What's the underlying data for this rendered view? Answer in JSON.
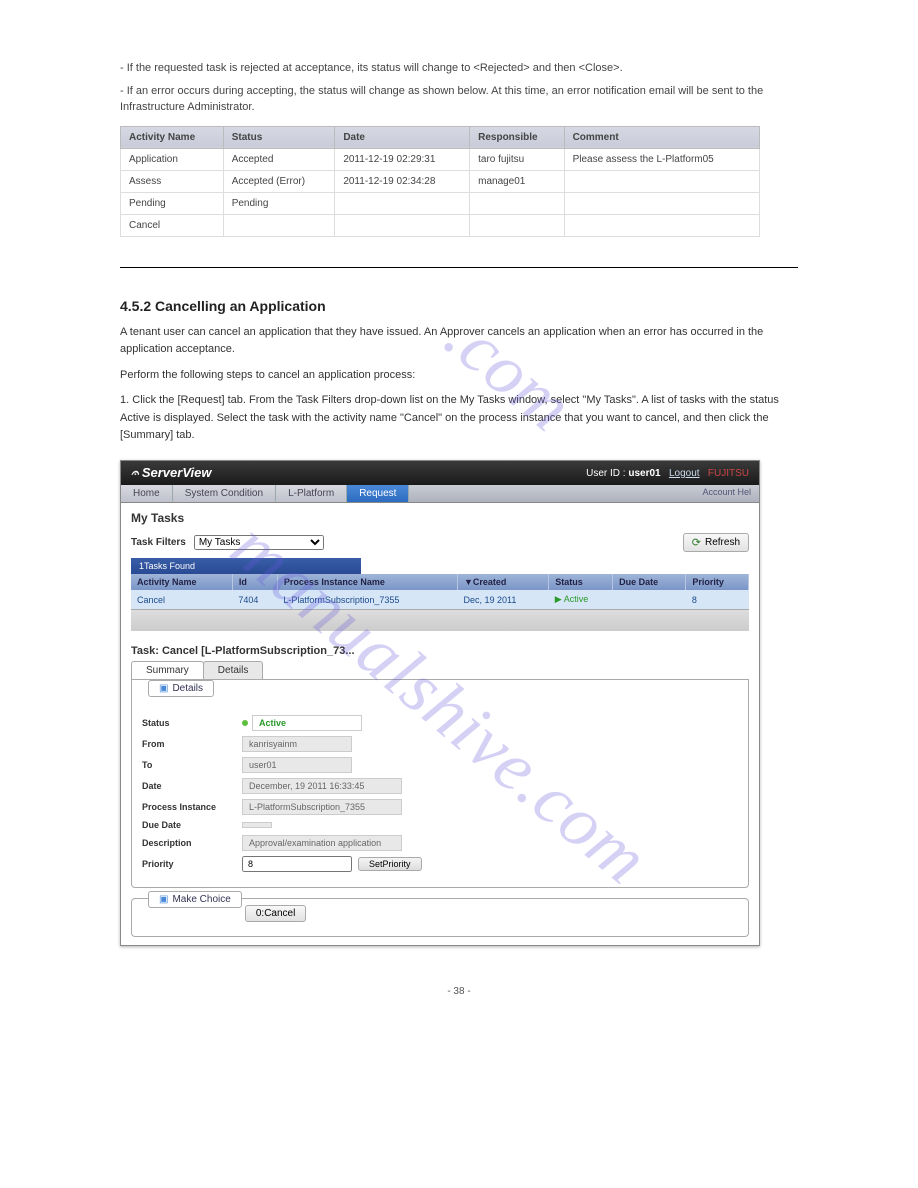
{
  "top_intro": "- If the requested task is rejected at acceptance, its status will change to <Rejected> and then <Close>.",
  "top_intro2": "- If an error occurs during accepting, the status will change as shown below. At this time, an error notification email will be sent to the Infrastructure Administrator.",
  "activity_table": {
    "headers": [
      "Activity Name",
      "Status",
      "Date",
      "Responsible",
      "Comment"
    ],
    "rows": [
      [
        "Application",
        "Accepted",
        "2011-12-19 02:29:31",
        "taro fujitsu",
        "Please assess the L-Platform05"
      ],
      [
        "Assess",
        "Accepted (Error)",
        "2011-12-19 02:34:28",
        "manage01",
        ""
      ],
      [
        "Pending",
        "Pending",
        "",
        "",
        ""
      ],
      [
        "Cancel",
        "",
        "",
        "",
        ""
      ]
    ]
  },
  "section_heading": "4.5.2 Cancelling an Application",
  "para1": "A tenant user can cancel an application that they have issued. An Approver cancels an application when an error has occurred in the application acceptance.",
  "para2": "Perform the following steps to cancel an application process:",
  "step1_label": "1.",
  "step1_text": "Click the [Request] tab. From the Task Filters drop-down list on the My Tasks window, select \"My Tasks\". A list of tasks with the status Active is displayed. Select the task with the activity name \"Cancel\" on the process instance that you want to cancel, and then click the [Summary] tab.",
  "sv": {
    "brand": "ServerView",
    "user_label": "User ID :",
    "user_id": "user01",
    "logout": "Logout",
    "logo": "FUJITSU",
    "tabs": [
      "Home",
      "System Condition",
      "L-Platform",
      "Request"
    ],
    "active_tab": 3,
    "account": "Account  Hel",
    "my_tasks": "My Tasks",
    "filter_label": "Task Filters",
    "filter_value": "My Tasks",
    "refresh": "Refresh",
    "tasks_found": "1Tasks Found",
    "grid_headers": [
      "Activity Name",
      "Id",
      "Process Instance Name",
      "Created",
      "Status",
      "Due Date",
      "Priority"
    ],
    "grid_row": {
      "activity": "Cancel",
      "id": "7404",
      "instance": "L-PlatformSubscription_7355",
      "created": "Dec, 19 2011",
      "status": "Active",
      "due": "",
      "priority": "8"
    },
    "task_title": "Task: Cancel [L-PlatformSubscription_73...",
    "inner_tabs": [
      "Summary",
      "Details"
    ],
    "active_inner": 0,
    "details_legend": "Details",
    "fields": {
      "status_label": "Status",
      "status_val": "Active",
      "from_label": "From",
      "from_val": "kanrisyainm",
      "to_label": "To",
      "to_val": "user01",
      "date_label": "Date",
      "date_val": "December, 19 2011 16:33:45",
      "pi_label": "Process Instance",
      "pi_val": "L-PlatformSubscription_7355",
      "due_label": "Due Date",
      "due_val": "",
      "desc_label": "Description",
      "desc_val": "Approval/examination application",
      "prio_label": "Priority",
      "prio_val": "8",
      "setprio": "SetPriority"
    },
    "choice_legend": "Make Choice",
    "cancel_btn": "0:Cancel"
  },
  "footer_left": "",
  "footer_page": "- 38 -"
}
